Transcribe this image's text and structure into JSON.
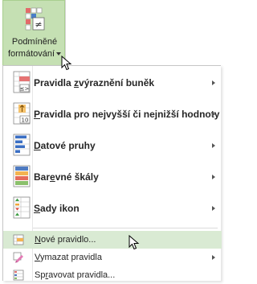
{
  "ribbon": {
    "button_line1": "Podmíněné",
    "button_line2": "formátování",
    "icon": "conditional-formatting-icon"
  },
  "menu": {
    "big_items": [
      {
        "id": "highlight",
        "label_pre": "Pravidla ",
        "label_ul": "z",
        "label_post": "výraznění buněk",
        "icon": "highlight-cells-icon",
        "has_submenu": true
      },
      {
        "id": "topbottom",
        "label_pre": "",
        "label_ul": "P",
        "label_post": "ravidla pro nejvyšší či nejnižší hodnoty",
        "icon": "top-bottom-icon",
        "has_submenu": true
      },
      {
        "id": "databars",
        "label_pre": "",
        "label_ul": "D",
        "label_post": "atové pruhy",
        "icon": "data-bars-icon",
        "has_submenu": true
      },
      {
        "id": "colorscales",
        "label_pre": "Bar",
        "label_ul": "e",
        "label_post": "vné škály",
        "icon": "color-scales-icon",
        "has_submenu": true
      },
      {
        "id": "iconsets",
        "label_pre": "",
        "label_ul": "S",
        "label_post": "ady ikon",
        "icon": "icon-sets-icon",
        "has_submenu": true
      }
    ],
    "small_items": [
      {
        "id": "new",
        "label_pre": "",
        "label_ul": "N",
        "label_post": "ové pravidlo...",
        "icon": "new-rule-icon",
        "highlighted": true,
        "has_submenu": false
      },
      {
        "id": "clear",
        "label_pre": "",
        "label_ul": "V",
        "label_post": "ymazat pravidla",
        "icon": "clear-rules-icon",
        "highlighted": false,
        "has_submenu": true
      },
      {
        "id": "manage",
        "label_pre": "Sp",
        "label_ul": "r",
        "label_post": "avovat pravidla...",
        "icon": "manage-rules-icon",
        "highlighted": false,
        "has_submenu": false
      }
    ],
    "highlight_color": "#d9ead3",
    "ribbon_active_color": "#c5e0b3"
  }
}
